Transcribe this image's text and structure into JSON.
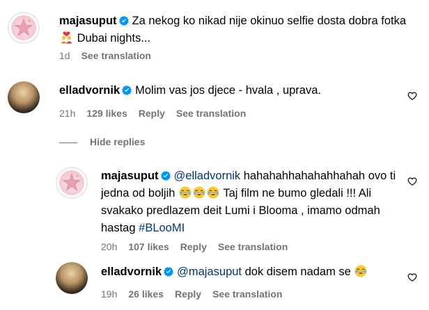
{
  "post": {
    "username": "majasuput",
    "caption_part1": "Za nekog ko nikad nije okinuo selfie dosta dobra fotka",
    "caption_part2": "Dubai nights...",
    "time": "1d",
    "see_translation": "See translation"
  },
  "comment1": {
    "username": "elladvornik",
    "text": "Molim vas jos djece - hvala , uprava.",
    "time": "21h",
    "likes": "129 likes",
    "reply": "Reply",
    "see_translation": "See translation"
  },
  "hide_replies": "Hide replies",
  "reply1": {
    "username": "majasuput",
    "mention": "@elladvornik",
    "text_part1": "hahahahhahahahhahah ovo ti jedna od boljih",
    "text_part2": "Taj film ne bumo gledali !!! Ali svakako predlazem deit Lumi i Blooma , imamo odmah hastag",
    "hashtag": "#BLooMI",
    "time": "20h",
    "likes": "107 likes",
    "reply": "Reply",
    "see_translation": "See translation"
  },
  "reply2": {
    "username": "elladvornik",
    "mention": "@majasuput",
    "text": "dok disem nadam se",
    "time": "19h",
    "likes": "26 likes",
    "reply": "Reply",
    "see_translation": "See translation"
  },
  "colors": {
    "verified": "#0095f6",
    "meta": "#737373",
    "mention": "#00376b"
  },
  "icons": [
    "verified-badge-icon",
    "heart-icon",
    "laughing-emoji-icon",
    "couple-heart-emoji-icon"
  ]
}
